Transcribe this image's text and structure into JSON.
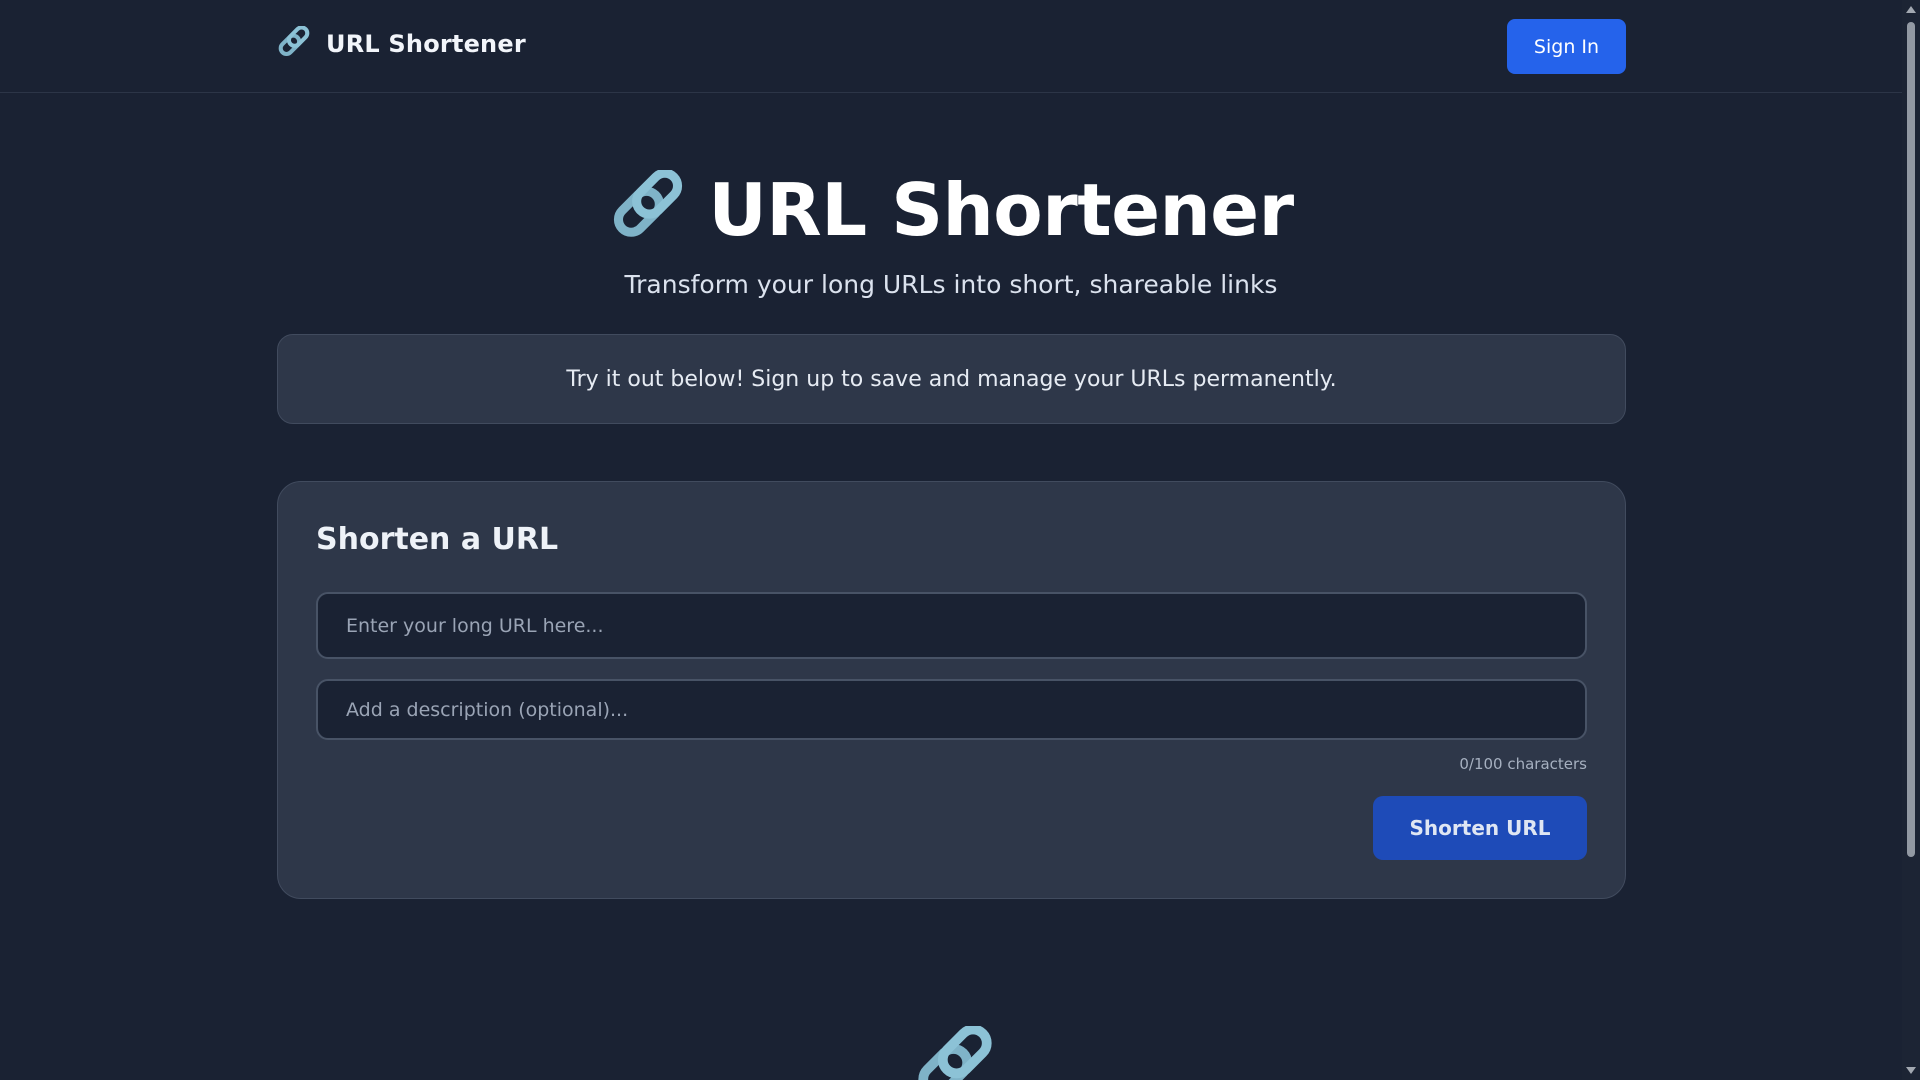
{
  "nav": {
    "brand_icon": "link-icon",
    "brand_label": "URL Shortener",
    "signin_label": "Sign In"
  },
  "hero": {
    "icon": "link-icon",
    "title": "URL Shortener",
    "subtitle": "Transform your long URLs into short, shareable links"
  },
  "banner": {
    "text": "Try it out below! Sign up to save and manage your URLs permanently."
  },
  "form": {
    "title": "Shorten a URL",
    "url_placeholder": "Enter your long URL here...",
    "url_value": "",
    "description_placeholder": "Add a description (optional)...",
    "description_value": "",
    "char_count": "0/100 characters",
    "submit_label": "Shorten URL"
  },
  "footer": {
    "icon": "link-icon"
  },
  "colors": {
    "background": "#1a2233",
    "card": "#2e3749",
    "accent": "#2563eb",
    "link_icon": "#7fb3c8"
  }
}
